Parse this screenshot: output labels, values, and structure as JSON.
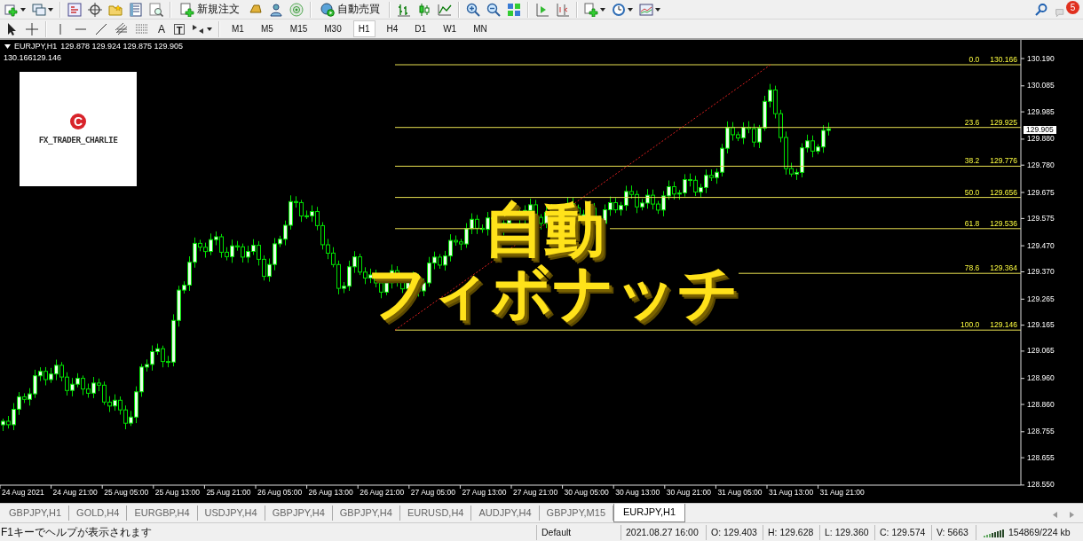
{
  "toolbar": {
    "buttons": [
      {
        "label": "新規注文"
      },
      {
        "label": "自動売買"
      }
    ],
    "text_tools": [
      "A",
      "T"
    ],
    "timeframes": [
      {
        "label": "M1",
        "selected": false
      },
      {
        "label": "M5",
        "selected": false
      },
      {
        "label": "M15",
        "selected": false
      },
      {
        "label": "M30",
        "selected": false
      },
      {
        "label": "H1",
        "selected": true
      },
      {
        "label": "H4",
        "selected": false
      },
      {
        "label": "D1",
        "selected": false
      },
      {
        "label": "W1",
        "selected": false
      },
      {
        "label": "MN",
        "selected": false
      }
    ],
    "notification_count": "5"
  },
  "chart": {
    "symbol": "EURJPY,H1",
    "ohlc": "129.878 129.924 129.875 129.905",
    "fib_range": "130.166129.146",
    "logo": {
      "mark": "C",
      "name": "FX_TRADER_CHARLIE"
    },
    "overlay_title": [
      "自動",
      "フィボナッチ"
    ],
    "fibonacci_levels": [
      {
        "ratio": "0.0",
        "price": "130.166"
      },
      {
        "ratio": "23.6",
        "price": "129.925"
      },
      {
        "ratio": "38.2",
        "price": "129.776"
      },
      {
        "ratio": "50.0",
        "price": "129.656"
      },
      {
        "ratio": "61.8",
        "price": "129.536"
      },
      {
        "ratio": "78.6",
        "price": "129.364"
      },
      {
        "ratio": "100.0",
        "price": "129.146"
      }
    ],
    "price_ticks": [
      "130.190",
      "130.085",
      "129.985",
      "129.880",
      "129.780",
      "129.675",
      "129.575",
      "129.470",
      "129.370",
      "129.265",
      "129.165",
      "129.065",
      "128.960",
      "128.860",
      "128.755",
      "128.655",
      "128.550"
    ],
    "current_price": "129.905",
    "time_labels": [
      "24 Aug 2021",
      "24 Aug 21:00",
      "25 Aug 05:00",
      "25 Aug 13:00",
      "25 Aug 21:00",
      "26 Aug 05:00",
      "26 Aug 13:00",
      "26 Aug 21:00",
      "27 Aug 05:00",
      "27 Aug 13:00",
      "27 Aug 21:00",
      "30 Aug 05:00",
      "30 Aug 13:00",
      "30 Aug 21:00",
      "31 Aug 05:00",
      "31 Aug 13:00",
      "31 Aug 21:00"
    ]
  },
  "tabs": [
    {
      "label": "GBPJPY,H1",
      "selected": false
    },
    {
      "label": "GOLD,H4",
      "selected": false
    },
    {
      "label": "EURGBP,H4",
      "selected": false
    },
    {
      "label": "USDJPY,H4",
      "selected": false
    },
    {
      "label": "GBPJPY,H4",
      "selected": false
    },
    {
      "label": "GBPJPY,H4",
      "selected": false
    },
    {
      "label": "EURUSD,H4",
      "selected": false
    },
    {
      "label": "AUDJPY,H4",
      "selected": false
    },
    {
      "label": "GBPJPY,M15",
      "selected": false
    },
    {
      "label": "EURJPY,H1",
      "selected": true
    }
  ],
  "status_bar": {
    "help": "F1キーでヘルプが表示されます",
    "profile": "Default",
    "datetime": "2021.08.27 16:00",
    "open": "O: 129.403",
    "high": "H: 129.628",
    "low": "L: 129.360",
    "close": "C: 129.574",
    "volume": "V: 5663",
    "memory": "154869/224 kb"
  }
}
